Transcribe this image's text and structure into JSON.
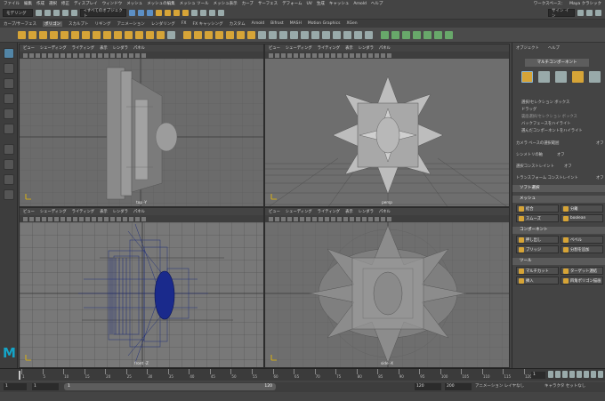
{
  "menubar": {
    "items": [
      "ファイル",
      "編集",
      "作成",
      "選択",
      "修正",
      "ディスプレイ",
      "ウィンドウ",
      "メッシュ",
      "メッシュの編集",
      "メッシュ ツール",
      "メッシュ表示",
      "カーブ",
      "サーフェス",
      "デフォーム",
      "UV",
      "生成",
      "キャッシュ",
      "Arnold",
      "ヘルプ"
    ],
    "workspace_label": "ワークスペース：",
    "workspace_value": "Maya クラシック"
  },
  "statusline": {
    "mode": "モデリング",
    "objects": "<すべてのオブジェクト",
    "sign_in": "サイン イン"
  },
  "shelftabs": [
    "カーブ/サーフェス",
    "ポリゴン",
    "スカルプト",
    "リギング",
    "アニメーション",
    "レンダリング",
    "FX",
    "FX キャッシング",
    "カスタム",
    "Arnold",
    "Bifrost",
    "MASH",
    "Motion Graphics",
    "XGen"
  ],
  "viewports": [
    {
      "menus": [
        "ビュー",
        "シェーディング",
        "ライティング",
        "表示",
        "レンダラ",
        "パネル"
      ],
      "camera": "top -Y"
    },
    {
      "menus": [
        "ビュー",
        "シェーディング",
        "ライティング",
        "表示",
        "レンダラ",
        "パネル"
      ],
      "camera": "persp"
    },
    {
      "menus": [
        "ビュー",
        "シェーディング",
        "ライティング",
        "表示",
        "レンダラ",
        "パネル"
      ],
      "camera": "front -Z"
    },
    {
      "menus": [
        "ビュー",
        "シェーディング",
        "ライティング",
        "表示",
        "レンダラ",
        "パネル"
      ],
      "camera": "side -X"
    }
  ],
  "rightpanel": {
    "tabs": [
      "オブジェクト",
      "ヘルプ"
    ],
    "mode_button": "マルチコンポーネント",
    "options": [
      "選択/セレクション ボックス",
      "ドラッグ",
      "裏面選択/セレクション ボックス",
      "バックフェースをハイライト",
      "選んだコンポーネントをハイライト"
    ],
    "camera_based": "カメラ ベースの選択範囲",
    "camera_based_val": "オフ",
    "symmetry": "シンメトリの軸",
    "symmetry_val": "オフ",
    "select_constraint": "選択コンストレイント",
    "select_constraint_val": "オフ",
    "transform_constraint": "トランスフォーム コンストレイント",
    "transform_constraint_val": "オフ",
    "sections": [
      "ソフト選択",
      "メッシュ",
      "コンポーネント",
      "ツール"
    ],
    "mesh_buttons": [
      "結合",
      "分離",
      "スムーズ",
      "boolean"
    ],
    "component_buttons": [
      "押し出し",
      "ベベル",
      "ブリッジ",
      "分割を追加"
    ],
    "tool_buttons": [
      "マルチカット",
      "ターゲット連結",
      "挿入",
      "四角ポリゴン描画"
    ]
  },
  "timeline": {
    "ticks": [
      "1",
      "5",
      "10",
      "15",
      "20",
      "25",
      "30",
      "35",
      "40",
      "45",
      "50",
      "55",
      "60",
      "65",
      "70",
      "75",
      "80",
      "85",
      "90",
      "95",
      "100",
      "105",
      "110",
      "115",
      "120"
    ],
    "current_frame": "1"
  },
  "range": {
    "start": "1",
    "inner_start": "1",
    "slider_start": "1",
    "slider_end": "120",
    "inner_end": "120",
    "end": "200",
    "anim_layer": "アニメーション レイヤなし",
    "char_set": "キャラクタ セットなし"
  },
  "colors": {
    "accent": "#5285a6",
    "viewport_bg": "#6b6b6b",
    "maya_logo": "#15a4c7",
    "front_mesh": "#2c3f9c"
  }
}
